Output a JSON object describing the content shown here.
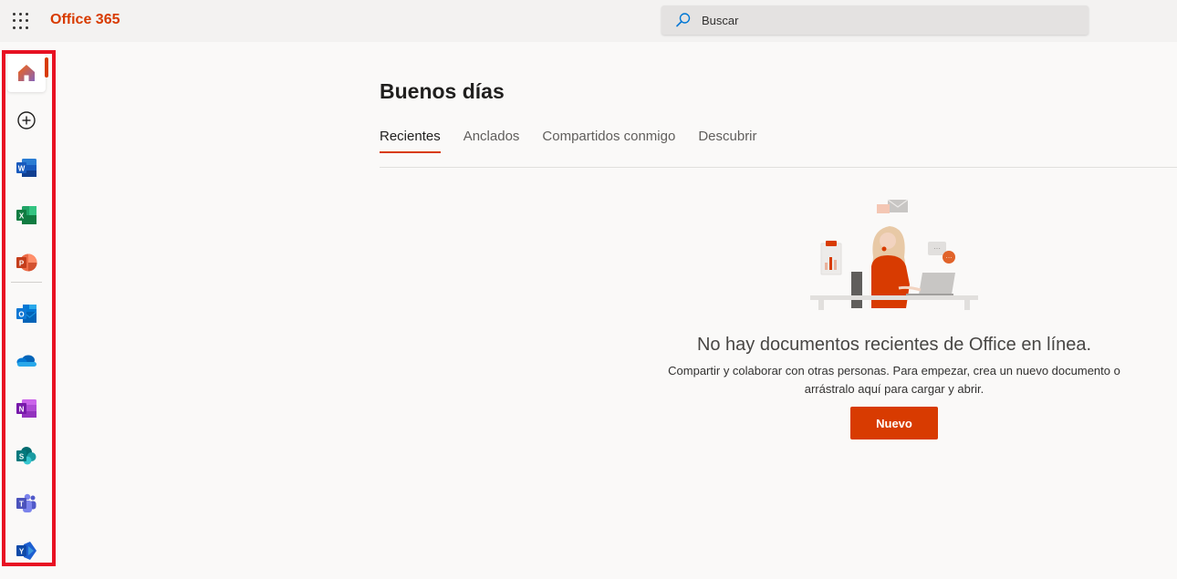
{
  "header": {
    "brand": "Office 365",
    "search_placeholder": "Buscar"
  },
  "rail": {
    "items": [
      "Inicio",
      "Crear",
      "Word",
      "Excel",
      "PowerPoint",
      "Outlook",
      "OneDrive",
      "OneNote",
      "SharePoint",
      "Teams",
      "Yammer"
    ]
  },
  "main": {
    "greeting": "Buenos días",
    "tabs": [
      "Recientes",
      "Anclados",
      "Compartidos conmigo",
      "Descubrir"
    ],
    "active_tab": "Recientes",
    "empty": {
      "title": "No hay documentos recientes de Office en línea.",
      "desc_line1": "Compartir y colaborar con otras personas. Para empezar, crea un nuevo documento o",
      "desc_line2": "arrástralo aquí para cargar y abrir.",
      "button": "Nuevo"
    }
  },
  "colors": {
    "accent": "#d83b01",
    "highlight_border": "#e81123"
  }
}
